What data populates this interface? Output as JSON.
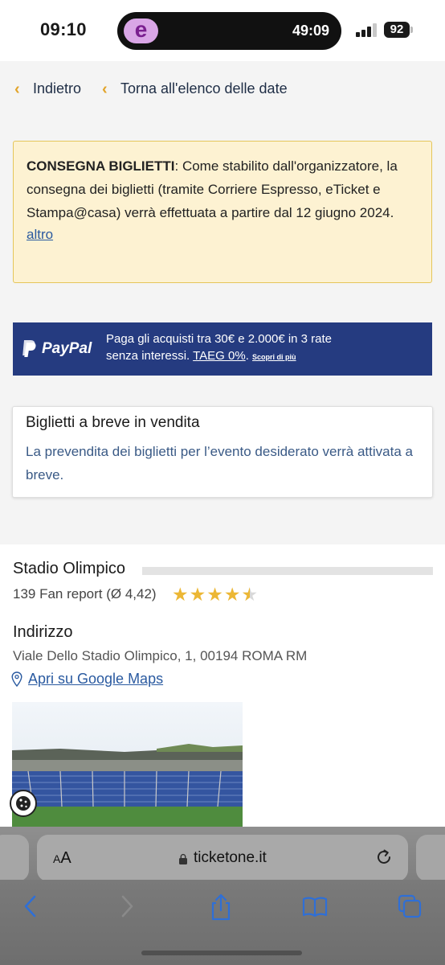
{
  "status_bar": {
    "time": "09:10",
    "app_badge": "e",
    "timer": "49:09",
    "battery": "92"
  },
  "nav": {
    "back_label": "Indietro",
    "dates_label": "Torna all'elenco delle date"
  },
  "notice": {
    "title": "CONSEGNA BIGLIETTI",
    "body": ": Come stabilito dall'organizzatore, la consegna dei biglietti (tramite Corriere Espresso, eTicket e Stampa@casa) verrà effettuata a partire dal 12 giugno 2024.",
    "more_link": "altro"
  },
  "paypal": {
    "brand": "PayPal",
    "line1": "Paga gli acquisti tra 30€ e 2.000€ in 3 rate",
    "line2_prefix": "senza interessi. ",
    "taeg": "TAEG 0%",
    "line2_dot": ". ",
    "more": "Scopri di più"
  },
  "soon": {
    "title": "Biglietti a breve in vendita",
    "text": "La prevendita dei biglietti per l’evento desiderato verrà attivata a breve."
  },
  "venue": {
    "name": "Stadio Olimpico",
    "fan_report": "139 Fan report (Ø 4,42)",
    "rating": 4.42,
    "rating_max": 5,
    "address_heading": "Indirizzo",
    "address": "Viale Dello Stadio Olimpico, 1, 00194 ROMA RM",
    "maps_link": "Apri su Google Maps"
  },
  "browser": {
    "aa_small": "A",
    "aa_large": "A",
    "url": "ticketone.it"
  },
  "icons": {
    "back": "chevron-left-icon",
    "forward": "chevron-right-icon",
    "share": "share-icon",
    "bookmarks": "book-icon",
    "tabs": "tabs-icon"
  },
  "colors": {
    "accent": "#e2a42a",
    "paypal": "#253b80",
    "link": "#2a5aa0",
    "notice_bg": "#fdf2d2",
    "safari_tint": "#2f6fd6"
  }
}
